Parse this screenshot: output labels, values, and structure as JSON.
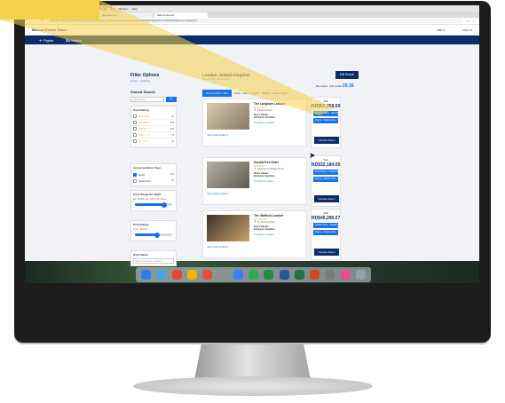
{
  "menubar": {
    "items": [
      "Chrome",
      "File",
      "Edit",
      "View",
      "History",
      "Bookmarks",
      "People",
      "Tab",
      "Window",
      "Help"
    ],
    "clock": "Thu 4:43 PM"
  },
  "browser": {
    "tabs": [
      "Inbox - sharon@marcusevans.com",
      "Expedia.com",
      "Marcus Evans"
    ],
    "address": "marcusevansflights.com/hotels/search/results?location=London,United Kingdom&checkin=04/06/2019&checkout=06/06/2019&rooms=1&adults=1"
  },
  "site": {
    "brand": "Marcus Evans Travel",
    "currency": "GBP ▾",
    "account": "SIGN IN",
    "nav": [
      "✈ Flights",
      "🛏 Hotels"
    ]
  },
  "filters": {
    "title": "Filter Options",
    "reset": "Reset · Collapse",
    "search_label": "Zoomd Search",
    "search_placeholder": "Hotel Name",
    "search_btn": "Go",
    "rating_head": "Hotel Rating",
    "ratings": [
      {
        "stars": "★★★★★",
        "count": "91"
      },
      {
        "stars": "★★★★☆",
        "count": "278"
      },
      {
        "stars": "★★★☆☆",
        "count": "222"
      },
      {
        "stars": "★★☆☆☆",
        "count": "17"
      },
      {
        "stars": "★☆☆☆☆",
        "count": "12"
      }
    ],
    "acc_head": "Accommodation Type",
    "acc_types": [
      {
        "label": "Hotel",
        "count": "443",
        "on": true
      },
      {
        "label": "Apartment",
        "count": "58",
        "on": false
      }
    ],
    "price_head": "Price Range Per Night",
    "price_text": "£0 - £2,500 per night, incl. taxes",
    "price_fraction": 0.78,
    "point_head": "Point Range",
    "point_text": "0 pts - 100 km",
    "point_fraction": 0.6,
    "name_head": "Hotel Name",
    "name_placeholder": "Enter hotel name / brand..."
  },
  "results": {
    "location": "London, United Kingdom",
    "dates": "04 Jun 2019 - 06 Jun 2019",
    "edit_btn": "Edit Search",
    "total_prefix": "Best deals · 544 results",
    "total_price": "29.35",
    "sort_active": "Sort by Price / Star",
    "sort_price": "Price - Low to High ▾",
    "sort_rating": "Rating - Low to High ▾",
    "hotels": [
      {
        "name": "The Langham London",
        "stars": "★★★★★",
        "addr": "📍 Portland Place",
        "meal": "Room Details\nExclusive Facilities",
        "trip": "TripAdvisor ●●●●●",
        "more": "View hotel details ▾",
        "price_label": "Total",
        "price": "RD$53,258.69",
        "options": [
          "Superior Room - Standard Rate",
          "Deluxe - Flexible Rate"
        ],
        "choose": "Choose Room"
      },
      {
        "name": "DoubleTree Hotel",
        "stars": "★★★★☆",
        "addr": "📍 Westminster Bridge Road",
        "meal": "Room Details\nExclusive Facilities",
        "trip": "TripAdvisor ●●●●○",
        "more": "View hotel details ▾",
        "price_label": "Total",
        "price": "RD$32,184.05",
        "options": [
          "Guest Room - Flexible Rate",
          "Deluxe - Flexible Rate"
        ],
        "choose": "Choose Room"
      },
      {
        "name": "The Stafford London",
        "stars": "★★★★★",
        "addr": "📍 St James's Place",
        "meal": "Room Details\nExclusive Facilities",
        "trip": "TripAdvisor ●●●●○",
        "more": "View hotel details ▾",
        "price_label": "Total",
        "price": "RD$45,295.27",
        "options": [
          "Classic Room - Flexible Rate",
          "Deluxe - Flexible Rate"
        ],
        "choose": "Choose Room"
      }
    ]
  },
  "dock": {
    "icons": [
      "finder-icon",
      "safari-icon",
      "chrome-icon",
      "photos-icon",
      "calendar-icon",
      "contacts-icon",
      "mail-icon",
      "maps-icon",
      "numbers-icon",
      "word-icon",
      "excel-icon",
      "powerpoint-icon",
      "settings-icon",
      "itunes-icon",
      "trash-icon"
    ],
    "colors": [
      "#2f7bf5",
      "#4fa3e0",
      "#e8453c",
      "#f4b400",
      "#e74c3c",
      "#8e8e93",
      "#3b82f6",
      "#34a853",
      "#1e8e3e",
      "#2b579a",
      "#217346",
      "#d24726",
      "#7a7a7a",
      "#ea4c89",
      "#9aa0a6"
    ]
  },
  "accent": "#0b2d6b",
  "highlight": "#f5d24a"
}
